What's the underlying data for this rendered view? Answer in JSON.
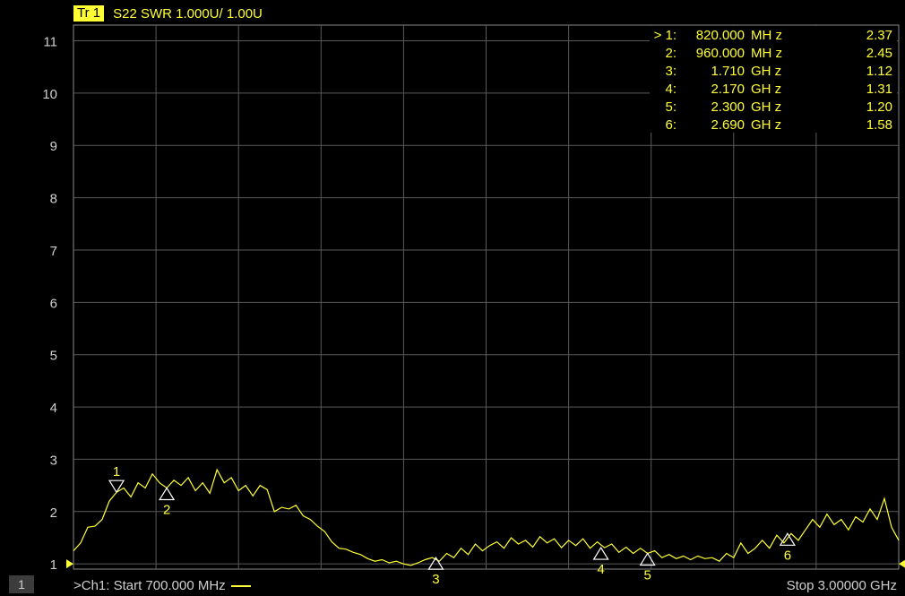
{
  "trace": {
    "badge": "Tr 1",
    "label": "S22 SWR 1.000U/  1.00U",
    "color": "#ffff33"
  },
  "status": {
    "channel_badge": "1",
    "start_text": ">Ch1:  Start   700.000 MHz",
    "stop_text": "Stop  3.00000 GHz"
  },
  "chart_data": {
    "type": "line",
    "x_unit": "MHz",
    "xlim": [
      700,
      3000
    ],
    "ylim": [
      0.9,
      11.3
    ],
    "yticks": [
      "1",
      "2",
      "3",
      "4",
      "5",
      "6",
      "7",
      "8",
      "9",
      "10",
      "11"
    ],
    "grid": true,
    "series": [
      {
        "x": [
          700,
          720,
          740,
          760,
          780,
          800,
          820,
          840,
          860,
          880,
          900,
          920,
          940,
          960,
          980,
          1000,
          1020,
          1040,
          1060,
          1080,
          1100,
          1120,
          1140,
          1160,
          1180,
          1200,
          1220,
          1240,
          1260,
          1280,
          1300,
          1320,
          1340,
          1360,
          1380,
          1400,
          1420,
          1440,
          1460,
          1480,
          1500,
          1520,
          1540,
          1560,
          1580,
          1600,
          1620,
          1640,
          1660,
          1680,
          1700,
          1720,
          1740,
          1760,
          1780,
          1800,
          1820,
          1840,
          1860,
          1880,
          1900,
          1920,
          1940,
          1960,
          1980,
          2000,
          2020,
          2040,
          2060,
          2080,
          2100,
          2120,
          2140,
          2160,
          2180,
          2200,
          2220,
          2240,
          2260,
          2280,
          2300,
          2320,
          2340,
          2360,
          2380,
          2400,
          2420,
          2440,
          2460,
          2480,
          2500,
          2520,
          2540,
          2560,
          2580,
          2600,
          2620,
          2640,
          2660,
          2680,
          2700,
          2720,
          2740,
          2760,
          2780,
          2800,
          2820,
          2840,
          2860,
          2880,
          2900,
          2920,
          2940,
          2960,
          2980,
          3000
        ],
        "y": [
          1.25,
          1.4,
          1.7,
          1.72,
          1.85,
          2.2,
          2.37,
          2.45,
          2.28,
          2.55,
          2.45,
          2.72,
          2.55,
          2.45,
          2.6,
          2.5,
          2.65,
          2.4,
          2.55,
          2.35,
          2.8,
          2.55,
          2.65,
          2.4,
          2.5,
          2.3,
          2.5,
          2.42,
          2.0,
          2.08,
          2.05,
          2.12,
          1.92,
          1.85,
          1.72,
          1.62,
          1.42,
          1.3,
          1.28,
          1.22,
          1.18,
          1.1,
          1.05,
          1.08,
          1.02,
          1.05,
          1.0,
          0.97,
          1.02,
          1.08,
          1.12,
          1.05,
          1.2,
          1.12,
          1.3,
          1.18,
          1.38,
          1.25,
          1.35,
          1.42,
          1.3,
          1.5,
          1.38,
          1.45,
          1.32,
          1.52,
          1.4,
          1.48,
          1.31,
          1.45,
          1.35,
          1.48,
          1.3,
          1.42,
          1.31,
          1.38,
          1.22,
          1.32,
          1.2,
          1.3,
          1.2,
          1.25,
          1.12,
          1.18,
          1.1,
          1.15,
          1.08,
          1.15,
          1.1,
          1.12,
          1.05,
          1.2,
          1.12,
          1.4,
          1.2,
          1.3,
          1.45,
          1.3,
          1.55,
          1.4,
          1.58,
          1.45,
          1.65,
          1.85,
          1.7,
          1.95,
          1.75,
          1.85,
          1.65,
          1.9,
          1.8,
          2.05,
          1.85,
          2.25,
          1.7,
          1.45
        ]
      }
    ],
    "markers": [
      {
        "id": "1",
        "x": 820,
        "y": 2.37,
        "freq": "820.000",
        "unit": "MH z",
        "value": "2.37",
        "active": true,
        "label_above": true
      },
      {
        "id": "2",
        "x": 960,
        "y": 2.45,
        "freq": "960.000",
        "unit": "MH z",
        "value": "2.45",
        "active": false,
        "label_above": false
      },
      {
        "id": "3",
        "x": 1710,
        "y": 1.12,
        "freq": "1.710",
        "unit": "GH z",
        "value": "1.12",
        "active": false,
        "label_above": false
      },
      {
        "id": "4",
        "x": 2170,
        "y": 1.31,
        "freq": "2.170",
        "unit": "GH z",
        "value": "1.31",
        "active": false,
        "label_above": false
      },
      {
        "id": "5",
        "x": 2300,
        "y": 1.2,
        "freq": "2.300",
        "unit": "GH z",
        "value": "1.20",
        "active": false,
        "label_above": false
      },
      {
        "id": "6",
        "x": 2690,
        "y": 1.58,
        "freq": "2.690",
        "unit": "GH z",
        "value": "1.58",
        "active": false,
        "label_above": false
      }
    ],
    "active_marker_prefix": ">"
  }
}
